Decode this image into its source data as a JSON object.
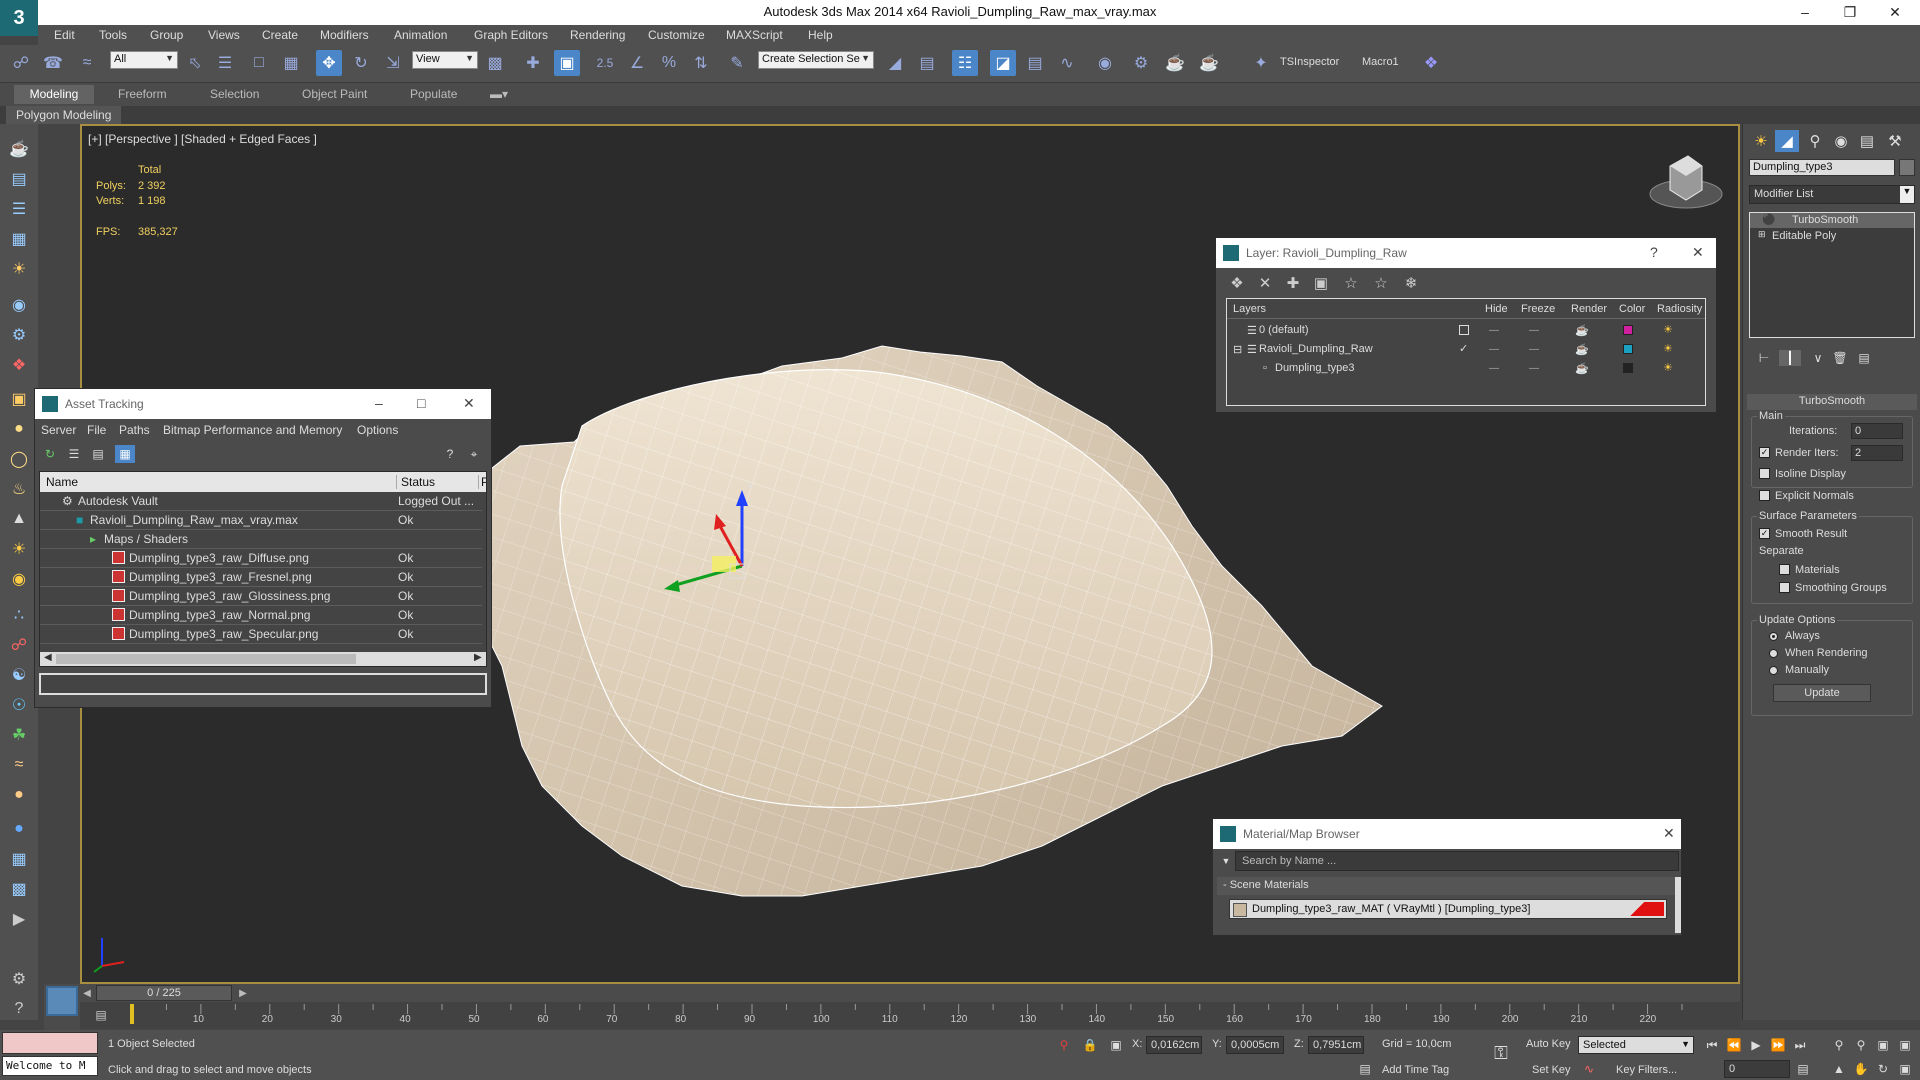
{
  "window": {
    "title": "Autodesk 3ds Max  2014 x64    Ravioli_Dumpling_Raw_max_vray.max",
    "logo_text": "3"
  },
  "menu": [
    "Edit",
    "Tools",
    "Group",
    "Views",
    "Create",
    "Modifiers",
    "Animation",
    "Graph Editors",
    "Rendering",
    "Customize",
    "MAXScript",
    "Help"
  ],
  "toolbar": {
    "selection_filter": "All",
    "ref_coord": "View",
    "snap_value": "2.5",
    "named_selection": "Create Selection Se",
    "tsinspector": "TSInspector",
    "macro": "Macro1"
  },
  "ribbon": {
    "tabs": [
      "Modeling",
      "Freeform",
      "Selection",
      "Object Paint",
      "Populate"
    ],
    "active_tab": "Modeling",
    "sub_tab": "Polygon Modeling"
  },
  "viewport": {
    "label": "[+] [Perspective ] [Shaded + Edged Faces ]",
    "stats": {
      "total_label": "Total",
      "polys_label": "Polys:",
      "polys": "2 392",
      "verts_label": "Verts:",
      "verts": "1 198",
      "fps_label": "FPS:",
      "fps": "385,327"
    },
    "gizmo_axis": "z"
  },
  "asset_tracking": {
    "title": "Asset Tracking",
    "menu": [
      "Server",
      "File",
      "Paths",
      "Bitmap Performance and Memory",
      "Options"
    ],
    "columns": [
      "Name",
      "Status",
      "P"
    ],
    "rows": [
      {
        "name": "Autodesk Vault",
        "status": "Logged Out ...",
        "depth": 1
      },
      {
        "name": "Ravioli_Dumpling_Raw_max_vray.max",
        "status": "Ok",
        "depth": 2
      },
      {
        "name": "Maps / Shaders",
        "status": "",
        "depth": 3
      },
      {
        "name": "Dumpling_type3_raw_Diffuse.png",
        "status": "Ok",
        "depth": 4
      },
      {
        "name": "Dumpling_type3_raw_Fresnel.png",
        "status": "Ok",
        "depth": 4
      },
      {
        "name": "Dumpling_type3_raw_Glossiness.png",
        "status": "Ok",
        "depth": 4
      },
      {
        "name": "Dumpling_type3_raw_Normal.png",
        "status": "Ok",
        "depth": 4
      },
      {
        "name": "Dumpling_type3_raw_Specular.png",
        "status": "Ok",
        "depth": 4
      }
    ]
  },
  "layer_window": {
    "title": "Layer: Ravioli_Dumpling_Raw",
    "help": "?",
    "columns": [
      "Layers",
      "Hide",
      "Freeze",
      "Render",
      "Color",
      "Radiosity"
    ],
    "rows": [
      {
        "name": "0 (default)",
        "color": "#d020a0"
      },
      {
        "name": "Ravioli_Dumpling_Raw",
        "color": "#1aa0c0"
      },
      {
        "name": "Dumpling_type3",
        "color": "#222222"
      }
    ]
  },
  "material_browser": {
    "title": "Material/Map Browser",
    "search_placeholder": "Search by Name ...",
    "section": "- Scene Materials",
    "material": "Dumpling_type3_raw_MAT  ( VRayMtl )  [Dumpling_type3]"
  },
  "command_panel": {
    "object_name": "Dumpling_type3",
    "modifier_list": "Modifier List",
    "stack": [
      "TurboSmooth",
      "Editable Poly"
    ],
    "rollout": "TurboSmooth",
    "main_label": "Main",
    "iterations_label": "Iterations:",
    "iterations": "0",
    "render_iters_label": "Render Iters:",
    "render_iters": "2",
    "isoline": "Isoline Display",
    "explicit_normals": "Explicit Normals",
    "surface_params": "Surface Parameters",
    "smooth_result": "Smooth Result",
    "separate": "Separate",
    "materials": "Materials",
    "smoothing_groups": "Smoothing Groups",
    "update_options": "Update Options",
    "always": "Always",
    "when_rendering": "When Rendering",
    "manually": "Manually",
    "update_button": "Update"
  },
  "timeline": {
    "frame_display": "0 / 225",
    "current_frame": 0,
    "total_frames": 225,
    "ticks": [
      "10",
      "20",
      "30",
      "40",
      "50",
      "60",
      "70",
      "80",
      "90",
      "100",
      "110",
      "120",
      "130",
      "140",
      "150",
      "160",
      "170",
      "180",
      "190",
      "200",
      "210",
      "220"
    ]
  },
  "status_bar": {
    "listener": "Welcome to M",
    "selection": "1 Object Selected",
    "prompt": "Click and drag to select and move objects",
    "x_label": "X:",
    "x": "0,0162cm",
    "y_label": "Y:",
    "y": "0,0005cm",
    "z_label": "Z:",
    "z": "0,7951cm",
    "grid": "Grid = 10,0cm",
    "add_time_tag": "Add Time Tag",
    "auto_key": "Auto Key",
    "set_key": "Set Key",
    "selected": "Selected",
    "key_filters": "Key Filters...",
    "frame": "0"
  }
}
